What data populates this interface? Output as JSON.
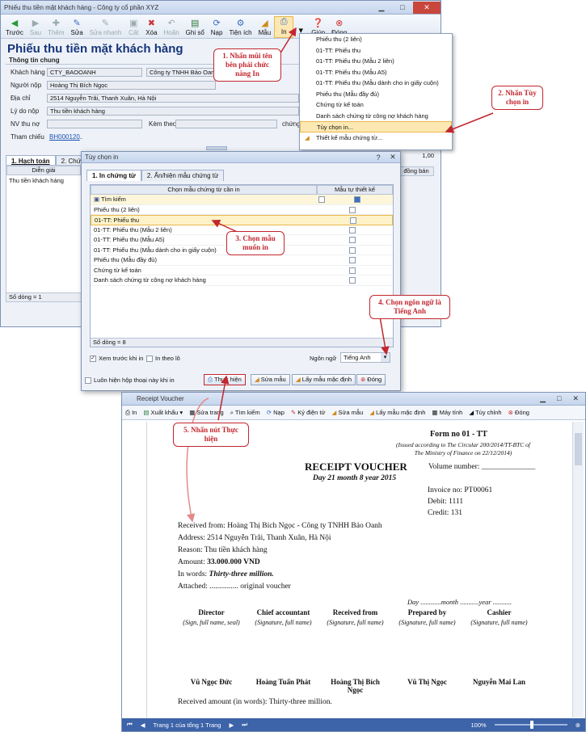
{
  "main_window": {
    "title": "Phiếu thu tiền mặt khách hàng - Công ty cổ phần XYZ",
    "toolbar": [
      {
        "label": "Trước",
        "icon": "back-arrow-icon",
        "enabled": true
      },
      {
        "label": "Sau",
        "icon": "forward-arrow-icon",
        "enabled": false
      },
      {
        "label": "Thêm",
        "icon": "add-icon",
        "enabled": false
      },
      {
        "label": "Sửa",
        "icon": "edit-icon",
        "enabled": true
      },
      {
        "label": "Sửa nhanh",
        "icon": "quick-edit-icon",
        "enabled": false
      },
      {
        "label": "Cất",
        "icon": "save-icon",
        "enabled": false
      },
      {
        "label": "Xóa",
        "icon": "delete-icon",
        "enabled": true
      },
      {
        "label": "Hoãn",
        "icon": "undo-icon",
        "enabled": false
      },
      {
        "label": "Ghi sổ",
        "icon": "post-ledger-icon",
        "enabled": true
      },
      {
        "label": "Nạp",
        "icon": "reload-icon",
        "enabled": true
      },
      {
        "label": "Tiện ích",
        "icon": "utility-icon",
        "enabled": true
      },
      {
        "label": "Mẫu",
        "icon": "template-icon",
        "enabled": true
      },
      {
        "label": "In",
        "icon": "print-icon",
        "enabled": true
      },
      {
        "label": "Giúp",
        "icon": "help-icon",
        "enabled": true
      },
      {
        "label": "Đóng",
        "icon": "close-icon",
        "enabled": true
      }
    ],
    "heading": "Phiếu thu tiền mặt khách hàng",
    "section": "Thông tin chung",
    "fields": {
      "customer_label": "Khách hàng",
      "customer_code": "CTY_BAOOANH",
      "customer_name": "Công ty TNHH Bảo Oanh",
      "payer_label": "Người nộp",
      "payer": "Hoàng Thị Bích Ngọc",
      "address_label": "Địa chỉ",
      "address": "2514 Nguyễn Trãi, Thanh Xuân, Hà Nội",
      "reason_label": "Lý do nộp",
      "reason": "Thu tiền khách hàng",
      "staff_label": "NV thu nợ",
      "attach_label": "Kèm theo",
      "voucher_label": "chứng",
      "ref_label": "Tham chiếu",
      "ref_value": "BH000120",
      "ref_more": "..."
    },
    "tabs": [
      "1. Hạch toán",
      "2. Chứng"
    ],
    "grid": {
      "col": "Diễn giải",
      "row": "Thu tiền khách hàng",
      "footer": "Số dòng = 1",
      "right_value": "1,00",
      "right_col": "đồng bán"
    }
  },
  "print_menu": {
    "items": [
      "Phiếu thu (2 liên)",
      "01-TT: Phiếu thu",
      "01-TT: Phiếu thu (Mẫu 2 liên)",
      "01-TT: Phiếu thu (Mẫu A5)",
      "01-TT: Phiếu thu (Mẫu dành cho in giấy cuộn)",
      "Phiếu thu (Mẫu đầy đủ)",
      "Chứng từ kế toán",
      "Danh sách chứng từ công nợ khách hàng",
      "Tùy chọn in...",
      "Thiết kế mẫu chứng từ..."
    ],
    "highlighted_index": 8
  },
  "dialog": {
    "title": "Tùy chọn in",
    "tabs": [
      "1. In chứng từ",
      "2. Ẩn/hiện mẫu chứng từ"
    ],
    "col1": "Chọn mẫu chứng từ cần in",
    "col2": "Mẫu tự thiết kế",
    "search": "Tìm kiếm",
    "rows": [
      "Phiếu thu (2 liên)",
      "01-TT: Phiếu thu",
      "01-TT: Phiếu thu (Mẫu 2 liên)",
      "01-TT: Phiếu thu (Mẫu A5)",
      "01-TT: Phiếu thu (Mẫu dành cho in giấy cuộn)",
      "Phiếu thu (Mẫu đầy đủ)",
      "Chứng từ kế toán",
      "Danh sách chứng từ công nợ khách hàng"
    ],
    "selected_index": 1,
    "footer": "Số dòng = 8",
    "preview": "Xem trước khi in",
    "preview_checked": true,
    "print_batch": "In theo lô",
    "language_label": "Ngôn ngữ",
    "language": "Tiếng Anh",
    "always_show": "Luôn hiện hộp thoại này khi in",
    "buttons": [
      "Thực hiện",
      "Sửa mẫu",
      "Lấy mẫu mặc định",
      "Đóng"
    ]
  },
  "callouts": [
    "1. Nhấn mũi tên bên phải chức năng In",
    "2. Nhấn Tùy chọn in",
    "3. Chọn mẫu muốn in",
    "4. Chọn ngôn ngữ là Tiếng Anh",
    "5. Nhấn nút Thực hiện"
  ],
  "report": {
    "title": "Receipt Voucher",
    "toolbar": [
      "In",
      "Xuất khẩu",
      "Sửa trang",
      "Tìm kiếm",
      "Nạp",
      "Ký điện tử",
      "Sửa mẫu",
      "Lấy mẫu mặc định",
      "Máy tính",
      "Tùy chỉnh",
      "Đóng"
    ],
    "form_no": "Form no 01 - TT",
    "issued": "(Issued according to The Circular 200/2014/TT-BTC of The Ministry of Finance  on 22/12/2014)",
    "heading": "RECEIPT VOUCHER",
    "date": "Day 21 month 8 year 2015",
    "volume": "Volume number: ______________",
    "invoice": "Invoice no:  PT00061",
    "debit": "Debit:  1111",
    "credit": "Credit:   131",
    "received_from": "Received from:  Hoàng Thị Bích Ngọc - Công ty TNHH Bảo Oanh",
    "address": "Address:  2514 Nguyễn Trãi, Thanh Xuân, Hà Nội",
    "reason": "Reason:  Thu tiền khách hàng",
    "amount_label": "Amount:",
    "amount": "33.000.000 VND",
    "words_label": "In words:",
    "words": "Thirty-three million.",
    "attached": "Attached: ............... original voucher",
    "day_line": "Day ............month ...........year ...........",
    "signers": [
      {
        "role": "Director",
        "hint": "(Sign, full name, seal)",
        "name": "Vũ Ngọc Đức"
      },
      {
        "role": "Chief accountant",
        "hint": "(Signature, full name)",
        "name": "Hoàng Tuấn Phát"
      },
      {
        "role": "Received from",
        "hint": "(Signature, full name)",
        "name": "Hoàng Thị Bích Ngọc"
      },
      {
        "role": "Prepared by",
        "hint": "(Signature, full name)",
        "name": "Vũ Thị Ngọc"
      },
      {
        "role": "Cashier",
        "hint": "(Signature, full name)",
        "name": "Nguyễn Mai Lan"
      }
    ],
    "received_words": "Received amount (in words):    Thirty-three million.",
    "status": "Trang 1 của tổng 1 Trang",
    "zoom": "100%"
  },
  "colors": {
    "callout": "#c2262e",
    "heading": "#16357a",
    "status_bar": "#3d63a9",
    "highlight": "#fde8b3"
  }
}
